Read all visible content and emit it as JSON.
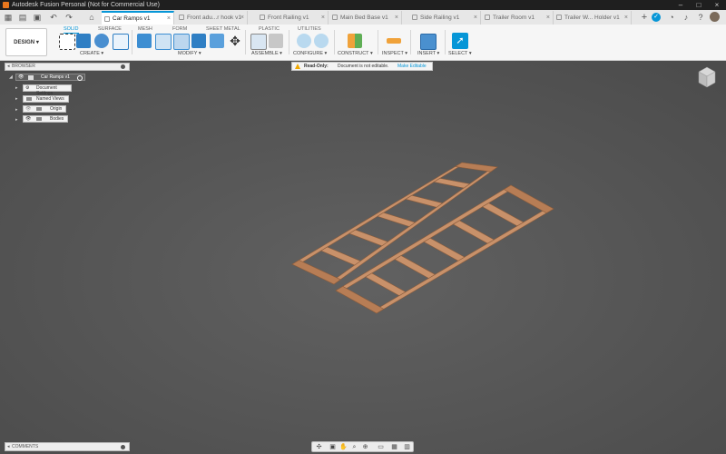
{
  "window": {
    "title": "Autodesk Fusion Personal (Not for Commercial Use)"
  },
  "tabs": [
    {
      "label": "Car Ramps v1",
      "active": true
    },
    {
      "label": "Front adu...r hook v1",
      "active": false
    },
    {
      "label": "Front Railing v1",
      "active": false
    },
    {
      "label": "Main Bed Base v1",
      "active": false
    },
    {
      "label": "Side Railing v1",
      "active": false
    },
    {
      "label": "Trailer Room v1",
      "active": false
    },
    {
      "label": "Trailer W... Holder v1",
      "active": false
    }
  ],
  "toolbar": {
    "workspace_label": "DESIGN",
    "workspace_tabs": [
      "SOLID",
      "SURFACE",
      "MESH",
      "FORM",
      "SHEET METAL",
      "PLASTIC",
      "UTILITIES"
    ],
    "groups": [
      "CREATE",
      "MODIFY",
      "ASSEMBLE",
      "CONFIGURE",
      "CONSTRUCT",
      "INSPECT",
      "INSERT",
      "SELECT"
    ]
  },
  "browser": {
    "title": "BROWSER",
    "root": "Car Ramps v1",
    "items": [
      "Document Settings",
      "Named Views",
      "Origin",
      "Bodies"
    ]
  },
  "banner": {
    "label": "Read-Only:",
    "message": "Document is not editable.",
    "action": "Make Editable"
  },
  "comments": {
    "title": "COMMENTS"
  },
  "icons": {
    "app": "fusion-logo-icon",
    "grid": "app-grid-icon",
    "file": "file-icon",
    "save": "save-icon",
    "undo": "undo-icon",
    "redo": "redo-icon",
    "home": "home-icon",
    "viewcube": "viewcube-icon"
  },
  "colors": {
    "accent": "#0696d7",
    "viewport": "#595959",
    "wood": "#c8916a",
    "banner_warning": "#f0a800"
  }
}
